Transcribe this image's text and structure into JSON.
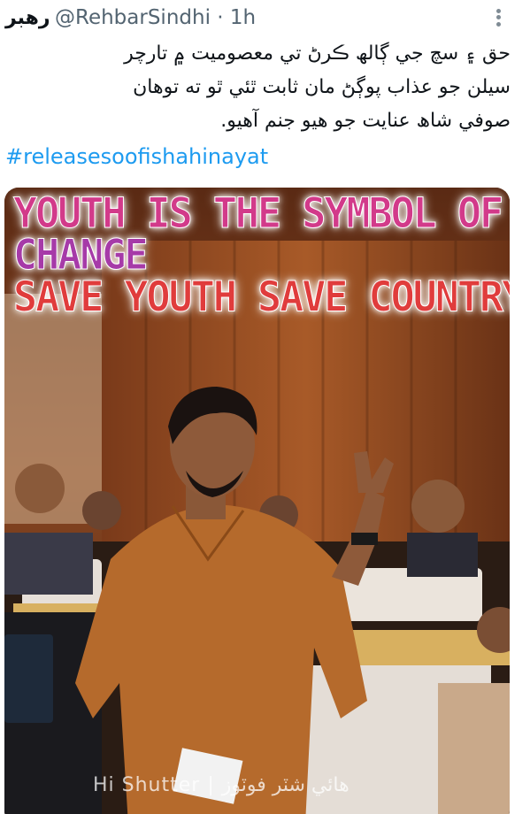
{
  "tweet": {
    "display_name": "رهبر",
    "handle_time": "@RehbarSindhi · 1h",
    "more_icon": "more-vertical-icon",
    "text_lines": [
      "حق ۽ سچ جي ڳالھ ڪرڻ تي معصوميت ۾ تارچر",
      "سيلن جو عذاب پوڳڻ مان ثابت ٿئي ٿو ته توھان",
      "صوفي شاھ عنايت جو ھيو جنم آھيو."
    ],
    "hashtag": "#releasesoofishahinayat"
  },
  "media": {
    "overlay_lines": [
      "YOUTH IS THE SYMBOL OF",
      "CHANGE",
      "SAVE YOUTH SAVE COUNTRY"
    ],
    "watermark": "Hi Shutter | ھائي شٽر فوٽوز"
  }
}
